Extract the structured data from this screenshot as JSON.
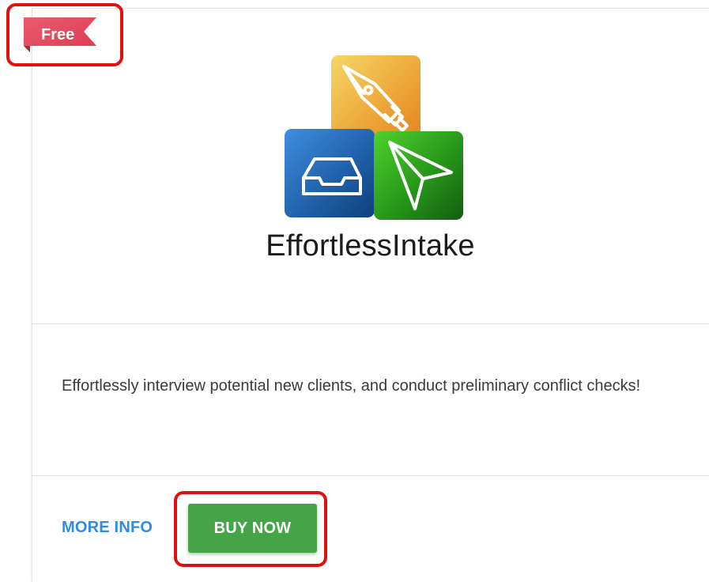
{
  "badge": {
    "label": "Free",
    "color": "#e84a5f"
  },
  "app": {
    "name": "EffortlessIntake",
    "description": "Effortlessly interview potential new clients, and conduct preliminary conflict checks!",
    "logo_icons": [
      "pen-nib-icon",
      "inbox-tray-icon",
      "paper-plane-icon"
    ]
  },
  "actions": {
    "more_info_label": "MORE INFO",
    "buy_now_label": "BUY NOW"
  },
  "colors": {
    "link": "#2f8be6",
    "primary_button": "#45a447",
    "highlight": "#e01010"
  }
}
